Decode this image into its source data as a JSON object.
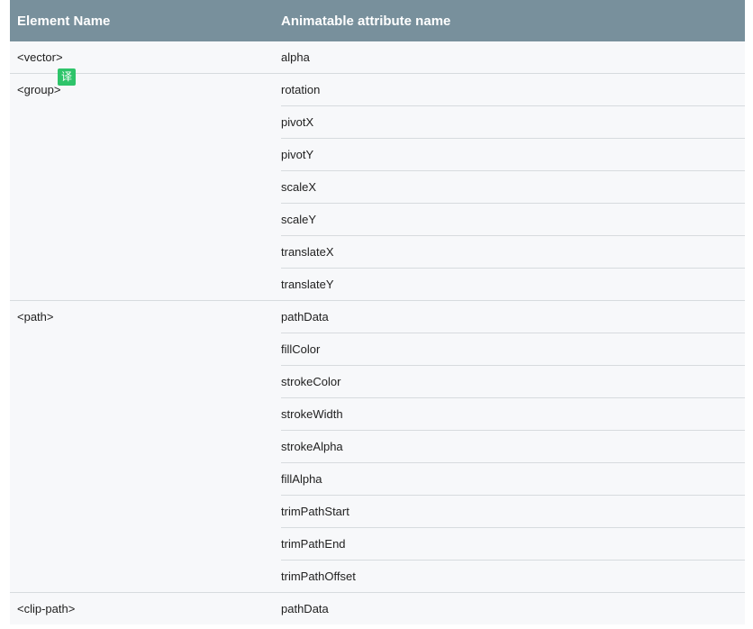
{
  "table": {
    "headers": {
      "element_name": "Element Name",
      "attribute_name": "Animatable attribute name"
    },
    "rows": [
      {
        "element": "<vector>",
        "attributes": [
          "alpha"
        ]
      },
      {
        "element": "<group>",
        "attributes": [
          "rotation",
          "pivotX",
          "pivotY",
          "scaleX",
          "scaleY",
          "translateX",
          "translateY"
        ]
      },
      {
        "element": "<path>",
        "attributes": [
          "pathData",
          "fillColor",
          "strokeColor",
          "strokeWidth",
          "strokeAlpha",
          "fillAlpha",
          "trimPathStart",
          "trimPathEnd",
          "trimPathOffset"
        ]
      },
      {
        "element": "<clip-path>",
        "attributes": [
          "pathData"
        ]
      }
    ]
  },
  "translate_badge": {
    "label": "译",
    "color": "#2ec46a"
  },
  "colors": {
    "header_bg": "#78909c",
    "row_bg": "#f7f8fa",
    "divider": "#d7dbde"
  }
}
